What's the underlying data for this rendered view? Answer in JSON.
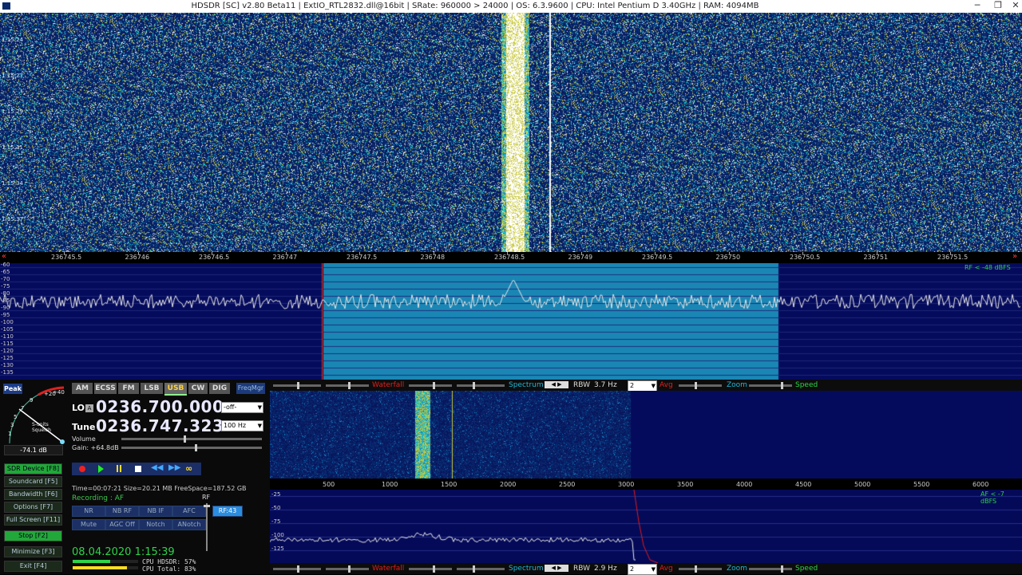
{
  "window": {
    "title": "HDSDR  [SC]  v2.80 Beta11  |  ExtIO_RTL2832.dll@16bit  |  SRate: 960000 > 24000  |  OS: 6.3.9600    |  CPU: Intel Pentium D 3.40GHz  |  RAM: 4094MB",
    "minimize": "─",
    "restore": "❐",
    "close": "✕"
  },
  "waterfall": {
    "time_labels": [
      "1:15:24",
      "1:15:27",
      "1:15:29",
      "1:15:31",
      "1:15:34",
      "1:15:37"
    ]
  },
  "freq_ruler": {
    "left_marker": "«",
    "right_marker": "»",
    "labels": [
      "236745.5",
      "236746",
      "236746.5",
      "236747",
      "236747.5",
      "236748",
      "236748.5",
      "236749",
      "236749.5",
      "236750",
      "236750.5",
      "236751",
      "236751.5"
    ]
  },
  "spectrum": {
    "db_labels": [
      "-60",
      "-65",
      "-70",
      "-75",
      "-80",
      "-85",
      "-90",
      "-95",
      "-100",
      "-105",
      "-110",
      "-115",
      "-120",
      "-125",
      "-130",
      "-135"
    ],
    "rf_level": "RF < -48 dBFS"
  },
  "smeter": {
    "peak_label": "Peak",
    "scale": [
      "+20",
      "+40",
      "9",
      "7",
      "5",
      "3",
      "1"
    ],
    "caption_1": "S-units",
    "caption_2": "Squelch",
    "value": "-74.1 dB"
  },
  "modes": [
    "AM",
    "ECSS",
    "FM",
    "LSB",
    "USB",
    "CW",
    "DIG"
  ],
  "active_mode": "USB",
  "freqmgr": "FreqMgr",
  "lo": {
    "label": "LO",
    "badge": "A",
    "value": "0236.700.000",
    "select": "-off-"
  },
  "tune": {
    "label": "Tune",
    "value": "0236.747.323",
    "select": "100 Hz"
  },
  "volume_label": "Volume",
  "gain_label": "Gain: +64.8dB",
  "left_buttons": [
    {
      "label": "SDR Device  [F8]",
      "on": true
    },
    {
      "label": "Soundcard  [F5]",
      "on": false
    },
    {
      "label": "Bandwidth  [F6]",
      "on": false
    },
    {
      "label": "Options  [F7]",
      "on": false
    },
    {
      "label": "Full Screen  [F11]",
      "on": false
    },
    {
      "label": "Stop  [F2]",
      "on": true
    },
    {
      "label": "Minimize  [F3]",
      "on": false
    },
    {
      "label": "Exit  [F4]",
      "on": false
    }
  ],
  "recording": {
    "info": "Time=00:07:21  Size=20.21 MB  FreeSpace=187.52 GB",
    "status": "Recording : AF"
  },
  "dsp_buttons_row1": [
    "NR",
    "NB RF",
    "NB IF",
    "AFC"
  ],
  "dsp_buttons_row2": [
    "Mute",
    "AGC Off",
    "Notch",
    "ANotch"
  ],
  "rf_button": "RF:43",
  "rf_label": "RF",
  "datetime": "08.04.2020 1:15:39",
  "cpu": {
    "hdsdr": "CPU HDSDR:  57%",
    "total": "CPU Total:  83%",
    "hdsdr_pct": 57,
    "total_pct": 83
  },
  "ctrlbar_top": {
    "waterfall": "Waterfall",
    "spectrum": "Spectrum",
    "rbw_label": "RBW",
    "rbw_value": "3.7 Hz",
    "avg_select": "2",
    "avg": "Avg",
    "zoom": "Zoom",
    "speed": "Speed"
  },
  "ctrlbar_bottom": {
    "waterfall": "Waterfall",
    "spectrum": "Spectrum",
    "rbw_label": "RBW",
    "rbw_value": "2.9 Hz",
    "avg_select": "2",
    "avg": "Avg",
    "zoom": "Zoom",
    "speed": "Speed"
  },
  "af_ruler": {
    "labels": [
      "500",
      "1000",
      "1500",
      "2000",
      "2500",
      "3000",
      "3500",
      "4000",
      "4500",
      "5000",
      "5500",
      "6000"
    ]
  },
  "af_spectrum": {
    "db_labels": [
      "-25",
      "-50",
      "-75",
      "-100",
      "-125"
    ],
    "level": "AF < -7 dBFS"
  },
  "colors": {
    "accent_green": "#22a83a",
    "accent_yellow": "#ffd23a",
    "waterfall_label": "#e02020",
    "spectrum_label": "#20b8d8",
    "passband": "#1a86b4",
    "tune_marker": "#ff2a00"
  }
}
